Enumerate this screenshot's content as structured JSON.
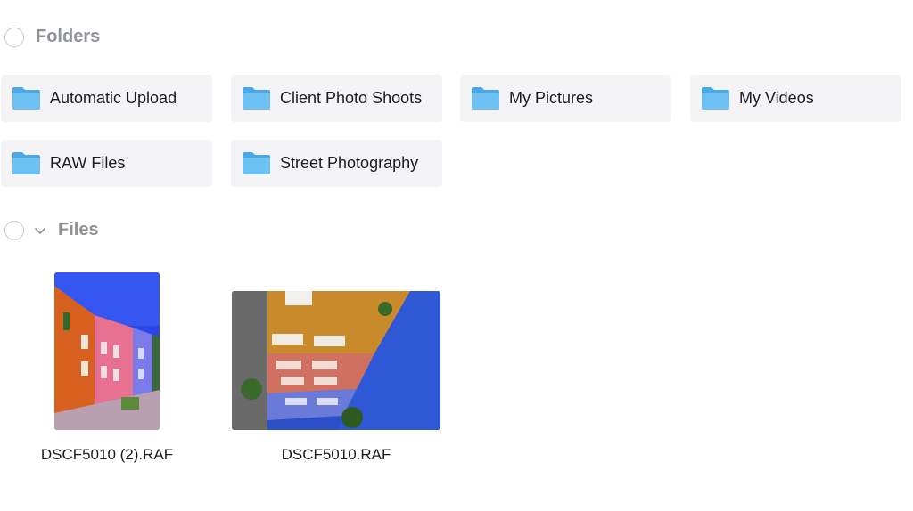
{
  "folders_section": {
    "title": "Folders"
  },
  "folders": [
    {
      "name": "Automatic Upload"
    },
    {
      "name": "Client Photo Shoots"
    },
    {
      "name": "My Pictures"
    },
    {
      "name": "My Videos"
    },
    {
      "name": "RAW Files"
    },
    {
      "name": "Street Photography"
    }
  ],
  "files_section": {
    "title": "Files"
  },
  "files": [
    {
      "name": "DSCF5010 (2).RAF",
      "orientation": "portrait"
    },
    {
      "name": "DSCF5010.RAF",
      "orientation": "landscape"
    }
  ],
  "icons": {
    "folder": "folder-icon",
    "chevron": "chevron-down-icon",
    "select": "select-circle-icon"
  },
  "colors": {
    "folder_icon": "#5ab4ee",
    "tile_bg": "#f4f4f6",
    "section_title": "#8e9196"
  }
}
